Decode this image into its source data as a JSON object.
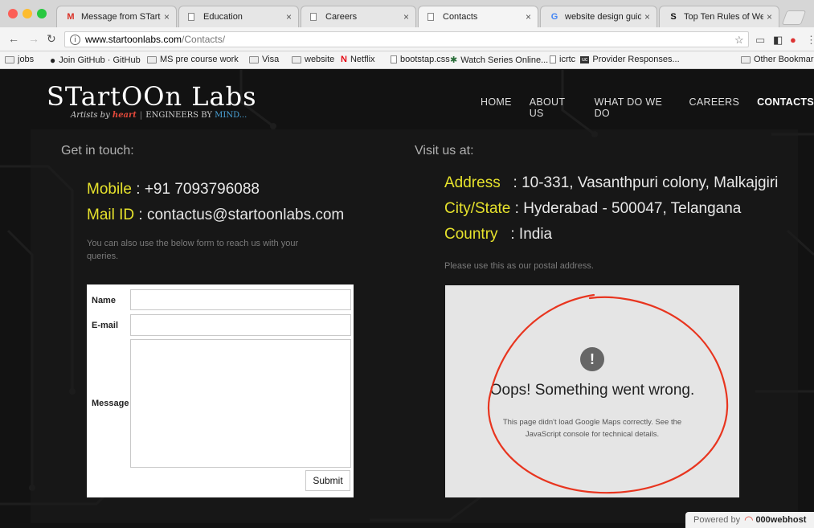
{
  "browser": {
    "tabs": [
      {
        "title": "Message from STartOO",
        "favicon": "M",
        "active": false
      },
      {
        "title": "Education",
        "favicon": "page",
        "active": false
      },
      {
        "title": "Careers",
        "favicon": "page",
        "active": false
      },
      {
        "title": "Contacts",
        "favicon": "page",
        "active": true
      },
      {
        "title": "website design guidelin",
        "favicon": "G",
        "active": false
      },
      {
        "title": "Top Ten Rules of Web D",
        "favicon": "S",
        "active": false
      }
    ],
    "url_host": "www.startoonlabs.com",
    "url_path": "/Contacts/",
    "bookmarks": [
      {
        "label": "jobs",
        "icon": "folder"
      },
      {
        "label": "Join GitHub · GitHub",
        "icon": "github"
      },
      {
        "label": "MS pre course work",
        "icon": "folder"
      },
      {
        "label": "Visa",
        "icon": "folder"
      },
      {
        "label": "website",
        "icon": "folder"
      },
      {
        "label": "Netflix",
        "icon": "netflix"
      },
      {
        "label": "bootstap.css",
        "icon": "page"
      },
      {
        "label": "Watch Series Online...",
        "icon": "star"
      },
      {
        "label": "icrtc",
        "icon": "page"
      },
      {
        "label": "Provider Responses...",
        "icon": "uc"
      }
    ],
    "other_bookmarks": "Other Bookmarks"
  },
  "site": {
    "logo_text": "STartOOn Labs",
    "tagline_prefix": "Artists by",
    "tagline_heart": "heart",
    "tagline_sep": "|",
    "tagline_engineers": "ENGINEERS BY",
    "tagline_mind": "MIND...",
    "nav": [
      {
        "label": "HOME",
        "active": false
      },
      {
        "label": "ABOUT US",
        "active": false
      },
      {
        "label": "WHAT DO WE DO",
        "active": false
      },
      {
        "label": "CAREERS",
        "active": false
      },
      {
        "label": "CONTACTS",
        "active": true
      }
    ]
  },
  "contact": {
    "heading": "Get in touch:",
    "mobile_label": "Mobile",
    "mobile_value": " : +91 7093796088",
    "mail_label": "Mail ID",
    "mail_value": " : contactus@startoonlabs.com",
    "note": "You can also use the below form to reach us with your queries.",
    "form": {
      "name_label": "Name",
      "email_label": "E-mail",
      "message_label": "Message",
      "submit_label": "Submit"
    }
  },
  "visit": {
    "heading": "Visit us at:",
    "address_label": "Address",
    "address_value": "   : 10-331, Vasanthpuri colony, Malkajgiri",
    "city_label": "City/State",
    "city_value": " : Hyderabad - 500047, Telangana",
    "country_label": "Country",
    "country_value": "   : India",
    "note": "Please use this as our postal address.",
    "map_error": {
      "alert": "!",
      "title": "Oops! Something went wrong.",
      "detail": "This page didn't load Google Maps correctly. See the JavaScript console for technical details."
    }
  },
  "footer": {
    "powered_by": "Powered by",
    "host": "000webhost"
  },
  "colors": {
    "accent_yellow": "#e6e22c",
    "scribble_red": "#e8351f"
  }
}
